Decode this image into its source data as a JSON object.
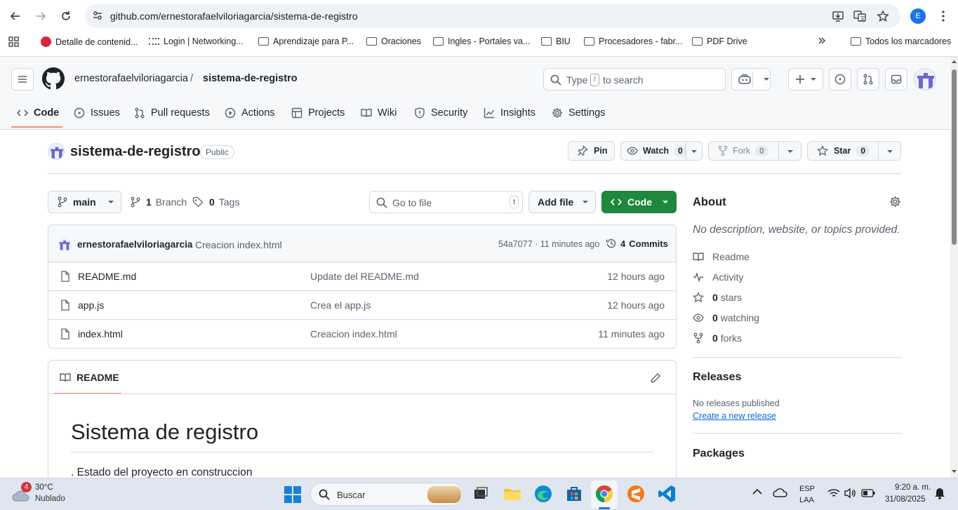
{
  "browser": {
    "url": "github.com/ernestorafaelviloriagarcia/sistema-de-registro",
    "profile_initial": "E",
    "bookmarks": [
      "Detalle de contenid...",
      "Login | Networking...",
      "Aprendizaje para P...",
      "Oraciones",
      "Ingles - Portales va...",
      "BIU",
      "Procesadores - fabr...",
      "PDF Drive"
    ],
    "all_bookmarks": "Todos los marcadores"
  },
  "header": {
    "owner": "ernestorafaelviloriagarcia",
    "separator": "/",
    "repo": "sistema-de-registro",
    "search_prefix": "Type",
    "search_key": "/",
    "search_suffix": "to search"
  },
  "tabs": [
    "Code",
    "Issues",
    "Pull requests",
    "Actions",
    "Projects",
    "Wiki",
    "Security",
    "Insights",
    "Settings"
  ],
  "repo": {
    "name": "sistema-de-registro",
    "visibility": "Public",
    "pin_label": "Pin",
    "watch_label": "Watch",
    "watch_count": "0",
    "fork_label": "Fork",
    "fork_count": "0",
    "star_label": "Star",
    "star_count": "0"
  },
  "toolbar": {
    "branch": "main",
    "branches_count": "1",
    "branches_label": "Branch",
    "tags_count": "0",
    "tags_label": "Tags",
    "go_to_file": "Go to file",
    "go_to_file_key": "t",
    "add_file": "Add file",
    "code": "Code"
  },
  "commit": {
    "author": "ernestorafaelviloriagarcia",
    "message": "Creacion index.html",
    "meta": "54a7077 · 11 minutes ago",
    "commits_count": "4",
    "commits_label": "Commits"
  },
  "files": [
    {
      "name": "README.md",
      "message": "Update del README.md",
      "date": "12 hours ago"
    },
    {
      "name": "app.js",
      "message": "Crea el app.js",
      "date": "12 hours ago"
    },
    {
      "name": "index.html",
      "message": "Creacion index.html",
      "date": "11 minutes ago"
    }
  ],
  "readme": {
    "tab_label": "README",
    "heading": "Sistema de registro",
    "body": ". Estado del proyecto en construccion"
  },
  "about": {
    "title": "About",
    "description": "No description, website, or topics provided.",
    "readme": "Readme",
    "activity": "Activity",
    "stars_count": "0",
    "stars_label": "stars",
    "watching_count": "0",
    "watching_label": "watching",
    "forks_count": "0",
    "forks_label": "forks",
    "releases_title": "Releases",
    "no_releases": "No releases published",
    "create_release": "Create a new release",
    "packages_title": "Packages"
  },
  "taskbar": {
    "weather_badge": "4",
    "temperature": "30°C",
    "condition": "Nublado",
    "search": "Buscar",
    "lang_top": "ESP",
    "lang_bottom": "LAA",
    "time": "9:20 a. m.",
    "date": "31/08/2025"
  },
  "colors": {
    "accent_green": "#1f883d",
    "tab_underline": "#fd8c73",
    "link_blue": "#0969da"
  }
}
